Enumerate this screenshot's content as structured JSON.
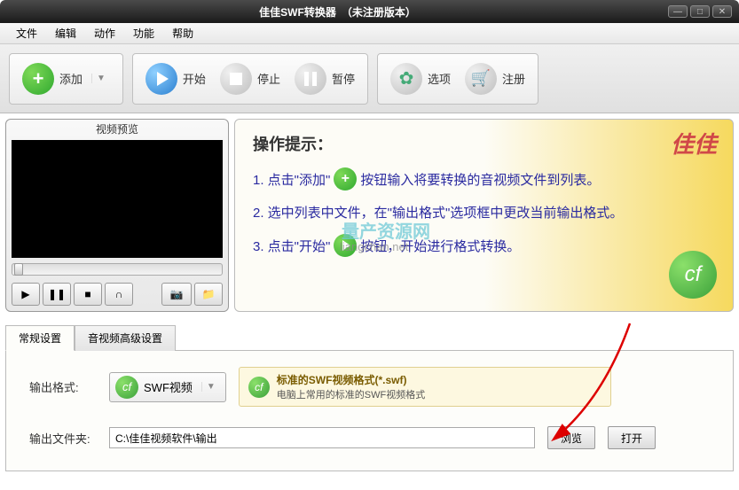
{
  "title": "佳佳SWF转换器　（未注册版本）",
  "menu": {
    "file": "文件",
    "edit": "编辑",
    "action": "动作",
    "function": "功能",
    "help": "帮助"
  },
  "toolbar": {
    "add": "添加",
    "start": "开始",
    "stop": "停止",
    "pause": "暂停",
    "options": "选项",
    "register": "注册"
  },
  "preview": {
    "title": "视频预览"
  },
  "tips": {
    "heading": "操作提示：",
    "line1a": "1. 点击\"添加\"",
    "line1b": "按钮输入将要转换的音视频文件到列表。",
    "line2": "2. 选中列表中文件，在\"输出格式\"选项框中更改当前输出格式。",
    "line3a": "3. 点击\"开始\"",
    "line3b": "按钮，开始进行格式转换。",
    "logo": "佳佳",
    "watermark": "量产资源网",
    "watermark2": "liangchan.net"
  },
  "tabs": {
    "general": "常规设置",
    "advanced": "音视频高级设置"
  },
  "settings": {
    "format_label": "输出格式:",
    "format_value": "SWF视频",
    "format_title": "标准的SWF视频格式(*.swf)",
    "format_desc": "电脑上常用的标准的SWF视频格式",
    "folder_label": "输出文件夹:",
    "folder_value": "C:\\佳佳视频软件\\输出",
    "browse": "浏览",
    "open": "打开"
  }
}
